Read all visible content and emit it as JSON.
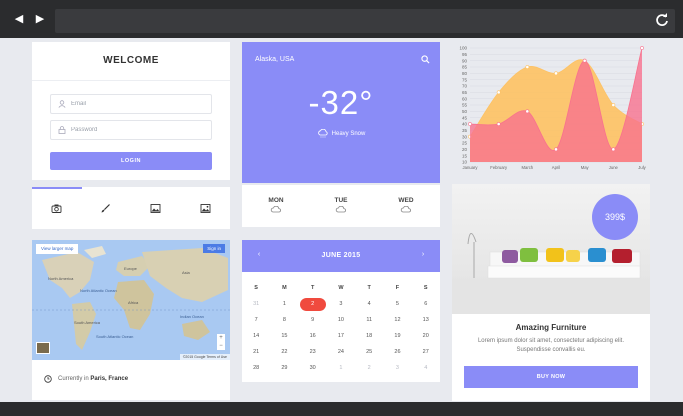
{
  "browser": {
    "back_icon": "back-arrow-icon",
    "forward_icon": "forward-arrow-icon",
    "reload_icon": "reload-icon"
  },
  "colors": {
    "accent": "#8a8cf7",
    "selected_day": "#f04a3e",
    "chart_orange": "#fdc265",
    "chart_pink": "#f8728e"
  },
  "welcome": {
    "title": "WELCOME",
    "email_placeholder": "Email",
    "password_placeholder": "Password",
    "login_label": "LOGIN"
  },
  "weather": {
    "location": "Alaska, USA",
    "temperature": "-32°",
    "condition": "Heavy Snow",
    "days": [
      {
        "label": "MON"
      },
      {
        "label": "TUE"
      },
      {
        "label": "WED"
      }
    ]
  },
  "tabs": {
    "icons": [
      "camera-icon",
      "brush-icon",
      "image-icon",
      "picture-icon"
    ]
  },
  "map": {
    "view_larger": "View larger map",
    "sign_in": "Sign in",
    "labels": {
      "north_america": "North America",
      "north_atlantic": "North Atlantic Ocean",
      "south_america": "South America",
      "europe": "Europe",
      "africa": "Africa",
      "asia": "Asia",
      "south_atlantic": "South Atlantic Ocean",
      "indian": "Indian Ocean"
    },
    "attribution": "©2015 Google  Terms of Use",
    "currently_in": "Currently in",
    "city": "Paris, France"
  },
  "calendar": {
    "month": "JUNE 2015",
    "weekdays": [
      "S",
      "M",
      "T",
      "W",
      "T",
      "F",
      "S"
    ],
    "weeks": [
      [
        [
          "31",
          "dim"
        ],
        [
          "1",
          ""
        ],
        [
          "2",
          "sel"
        ],
        [
          "3",
          ""
        ],
        [
          "4",
          ""
        ],
        [
          "5",
          ""
        ],
        [
          "6",
          ""
        ]
      ],
      [
        [
          "7",
          ""
        ],
        [
          "8",
          ""
        ],
        [
          "9",
          ""
        ],
        [
          "10",
          ""
        ],
        [
          "11",
          ""
        ],
        [
          "12",
          ""
        ],
        [
          "13",
          ""
        ]
      ],
      [
        [
          "14",
          ""
        ],
        [
          "15",
          ""
        ],
        [
          "16",
          ""
        ],
        [
          "17",
          ""
        ],
        [
          "18",
          ""
        ],
        [
          "19",
          ""
        ],
        [
          "20",
          ""
        ]
      ],
      [
        [
          "21",
          ""
        ],
        [
          "22",
          ""
        ],
        [
          "23",
          ""
        ],
        [
          "24",
          ""
        ],
        [
          "25",
          ""
        ],
        [
          "26",
          ""
        ],
        [
          "27",
          ""
        ]
      ],
      [
        [
          "28",
          ""
        ],
        [
          "29",
          ""
        ],
        [
          "30",
          ""
        ],
        [
          "1",
          "dim"
        ],
        [
          "2",
          "dim"
        ],
        [
          "3",
          "dim"
        ],
        [
          "4",
          "dim"
        ]
      ]
    ]
  },
  "furniture": {
    "price": "399$",
    "title": "Amazing Furniture",
    "description": "Lorem ipsum dolor sit amet, consectetur adipiscing elit. Suspendisse convallis eu.",
    "buy_label": "BUY NOW"
  },
  "chart_data": {
    "type": "area",
    "categories": [
      "January",
      "February",
      "March",
      "April",
      "May",
      "June",
      "July"
    ],
    "ylim": [
      10,
      100
    ],
    "yticks": [
      10,
      15,
      20,
      25,
      30,
      35,
      40,
      45,
      50,
      55,
      60,
      65,
      70,
      75,
      80,
      85,
      90,
      95,
      100
    ],
    "series": [
      {
        "values": [
          30,
          65,
          85,
          80,
          90,
          55,
          40
        ],
        "color": "#fdc265"
      },
      {
        "values": [
          40,
          40,
          50,
          20,
          90,
          20,
          100
        ],
        "color": "#f8728e"
      }
    ],
    "grid": true
  }
}
